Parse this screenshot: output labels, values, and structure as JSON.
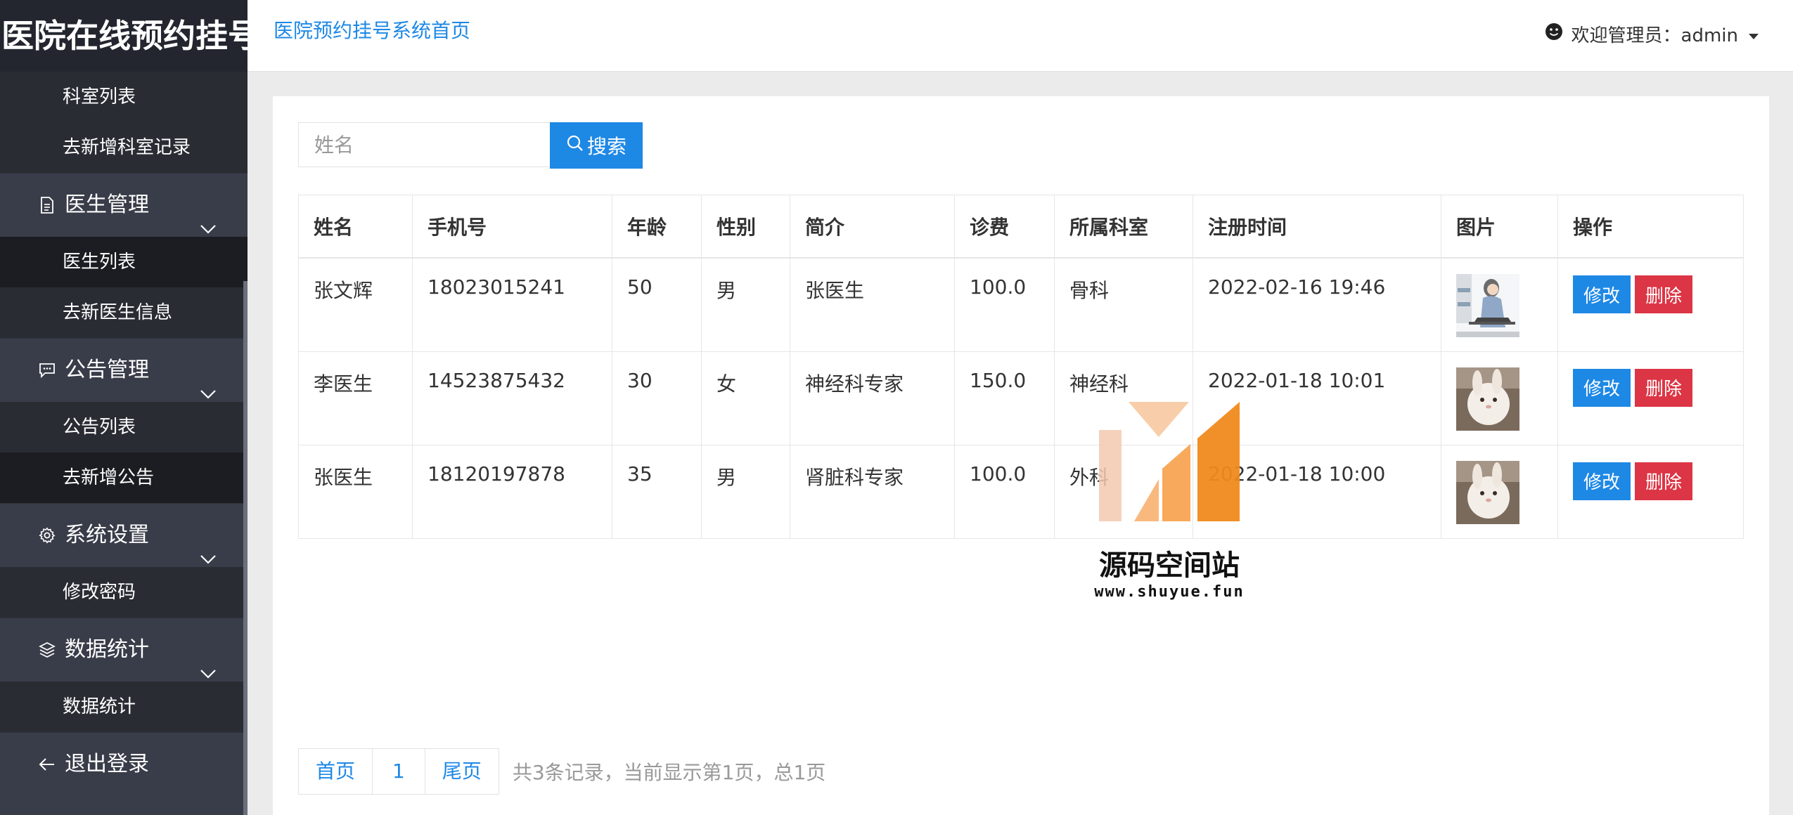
{
  "app": {
    "title": "医院在线预约挂号"
  },
  "header": {
    "home_link": "医院预约挂号系统首页",
    "user_label": "欢迎管理员：admin"
  },
  "sidebar": {
    "dept_items": [
      "科室列表",
      "去新增科室记录"
    ],
    "doctor_group": "医生管理",
    "doctor_items": [
      "医生列表",
      "去新医生信息"
    ],
    "notice_group": "公告管理",
    "notice_items": [
      "公告列表",
      "去新增公告"
    ],
    "settings_group": "系统设置",
    "settings_items": [
      "修改密码"
    ],
    "stats_group": "数据统计",
    "stats_items": [
      "数据统计"
    ],
    "logout": "退出登录"
  },
  "search": {
    "placeholder": "姓名",
    "button": "搜索"
  },
  "table": {
    "headers": [
      "姓名",
      "手机号",
      "年龄",
      "性别",
      "简介",
      "诊费",
      "所属科室",
      "注册时间",
      "图片",
      "操作"
    ],
    "rows": [
      {
        "name": "张文辉",
        "phone": "18023015241",
        "age": "50",
        "gender": "男",
        "intro": "张医生",
        "fee": "100.0",
        "dept": "骨科",
        "time": "2022-02-16 19:46",
        "image": "person-at-laptop-drawing"
      },
      {
        "name": "李医生",
        "phone": "14523875432",
        "age": "30",
        "gender": "女",
        "intro": "神经科专家",
        "fee": "150.0",
        "dept": "神经科",
        "time": "2022-01-18 10:01",
        "image": "white-rabbit-photo"
      },
      {
        "name": "张医生",
        "phone": "18120197878",
        "age": "35",
        "gender": "男",
        "intro": "肾脏科专家",
        "fee": "100.0",
        "dept": "外科",
        "time": "2022-01-18 10:00",
        "image": "white-rabbit-photo"
      }
    ],
    "edit_label": "修改",
    "delete_label": "删除"
  },
  "watermark": {
    "title": "源码空间站",
    "url": "www.shuyue.fun"
  },
  "pagination": {
    "first": "首页",
    "page": "1",
    "last": "尾页",
    "info": "共3条记录，当前显示第1页，总1页"
  },
  "colors": {
    "primary": "#1E88E5",
    "danger": "#dc3545",
    "sidebar": "#393D49",
    "brand_bg": "#23262e"
  }
}
